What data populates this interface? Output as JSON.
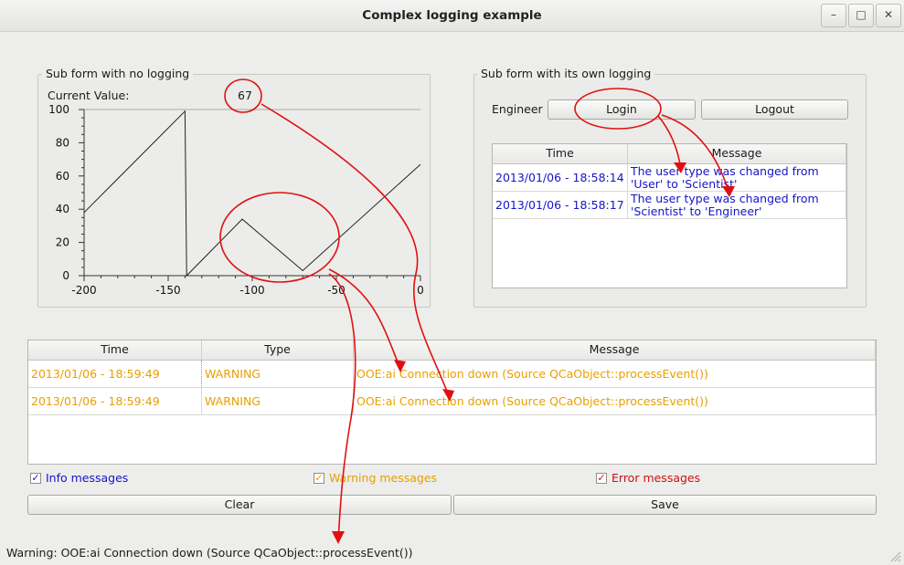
{
  "window": {
    "title": "Complex logging example",
    "min_glyph": "–",
    "max_glyph": "□",
    "close_glyph": "✕"
  },
  "left_group": {
    "title": "Sub form with no logging",
    "current_value_label": "Current Value:",
    "current_value": "67"
  },
  "chart_data": {
    "type": "line",
    "title": "",
    "xlabel": "",
    "ylabel": "",
    "xlim": [
      -200,
      0
    ],
    "ylim": [
      0,
      100
    ],
    "x_ticks": [
      "-200",
      "-150",
      "-100",
      "-50",
      "0"
    ],
    "y_ticks": [
      "100",
      "80",
      "60",
      "40",
      "20",
      "0"
    ],
    "series": [
      {
        "points": [
          [
            -200,
            38
          ],
          [
            -140,
            99
          ],
          [
            -139,
            0
          ],
          [
            -106,
            34
          ],
          [
            -70,
            3
          ],
          [
            0,
            67
          ]
        ]
      }
    ]
  },
  "right_group": {
    "title": "Sub form with its own logging",
    "user_label": "Engineer",
    "login_label": "Login",
    "logout_label": "Logout",
    "columns": [
      "Time",
      "Message"
    ],
    "rows": [
      {
        "time": "2013/01/06 - 18:58:14",
        "message_line1": "The user type was changed from",
        "message_line2": "'User' to 'Scientist'"
      },
      {
        "time": "2013/01/06 - 18:58:17",
        "message_line1": "The user type was changed from",
        "message_line2": "'Scientist' to 'Engineer'"
      }
    ]
  },
  "main_log": {
    "columns": [
      "Time",
      "Type",
      "Message"
    ],
    "rows": [
      {
        "time": "2013/01/06 - 18:59:49",
        "type": "WARNING",
        "message": "OOE:ai Connection down (Source QCaObject::processEvent())"
      },
      {
        "time": "2013/01/06 - 18:59:49",
        "type": "WARNING",
        "message": "OOE:ai Connection down (Source QCaObject::processEvent())"
      }
    ]
  },
  "filters": {
    "info": "Info messages",
    "warning": "Warning messages",
    "error": "Error messages",
    "check_glyph": "✓"
  },
  "buttons": {
    "clear": "Clear",
    "save": "Save"
  },
  "status_bar": {
    "text": "Warning: OOE:ai Connection down (Source QCaObject::processEvent())"
  },
  "colors": {
    "info": "#1515c8",
    "warning": "#e8a000",
    "error": "#d01010",
    "annotation": "#e01010"
  }
}
